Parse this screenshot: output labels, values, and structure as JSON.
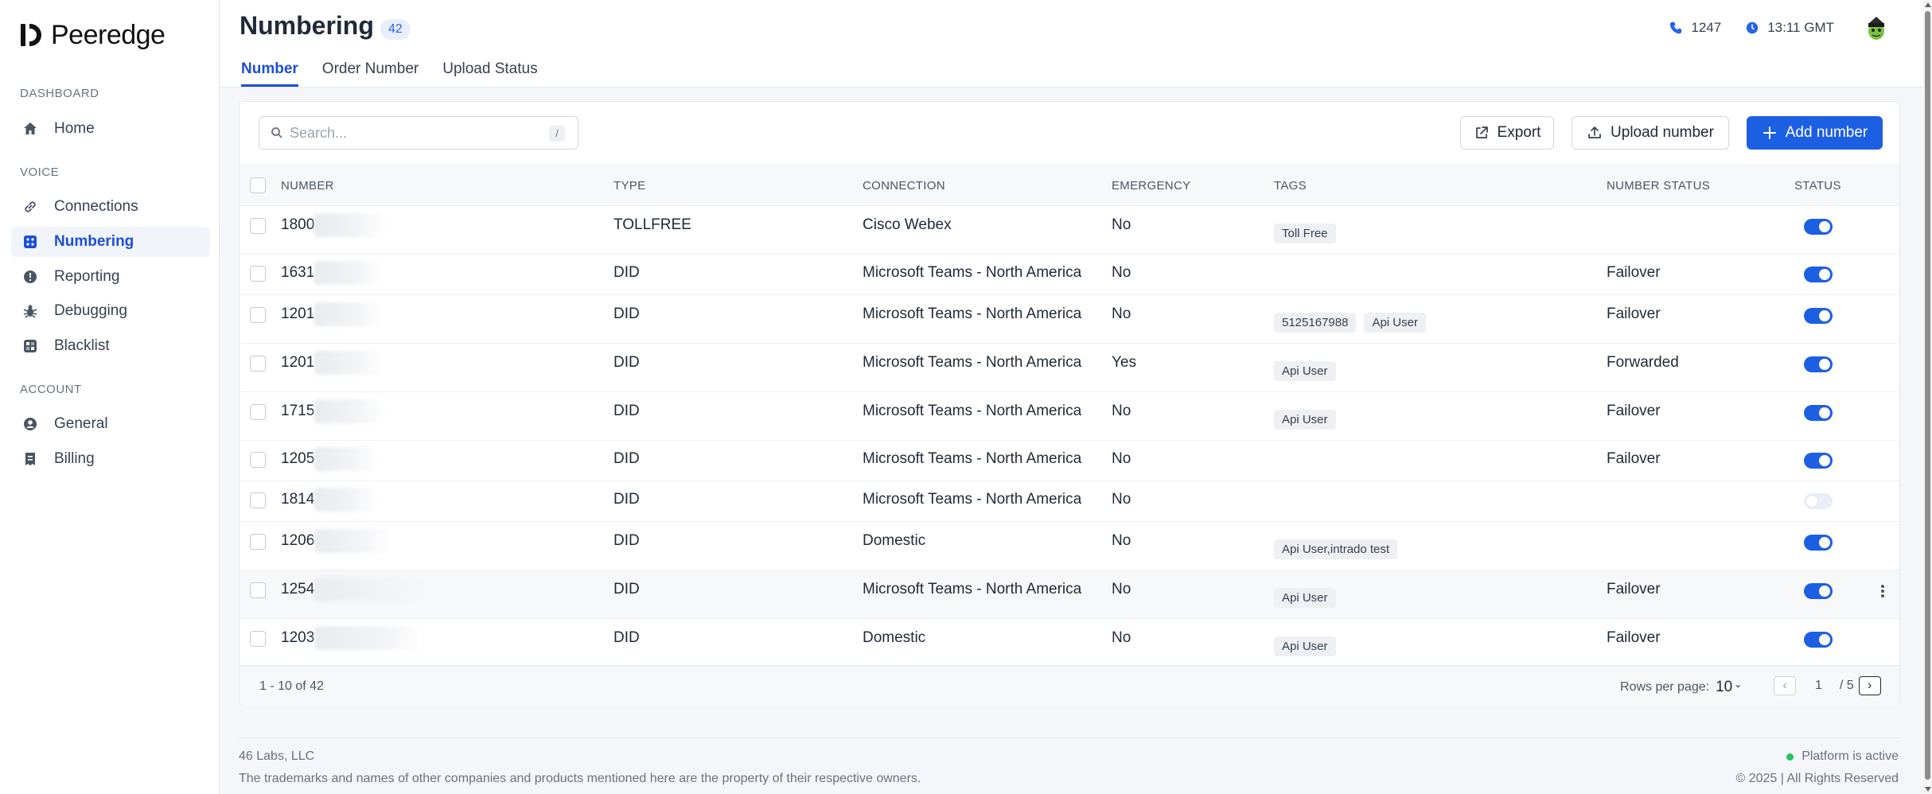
{
  "app": {
    "name": "Peeredge"
  },
  "sidebar": {
    "sections": [
      {
        "label": "DASHBOARD"
      },
      {
        "label": "VOICE"
      },
      {
        "label": "ACCOUNT"
      }
    ],
    "items": [
      {
        "label": "Home",
        "icon": "home-icon"
      },
      {
        "label": "Connections",
        "icon": "link-icon"
      },
      {
        "label": "Numbering",
        "icon": "grid-icon",
        "active": true
      },
      {
        "label": "Reporting",
        "icon": "alert-circle-icon"
      },
      {
        "label": "Debugging",
        "icon": "bug-icon"
      },
      {
        "label": "Blacklist",
        "icon": "blacklist-icon"
      },
      {
        "label": "General",
        "icon": "user-circle-icon"
      },
      {
        "label": "Billing",
        "icon": "receipt-icon"
      }
    ]
  },
  "header": {
    "title": "Numbering",
    "count": "42",
    "tabs": [
      {
        "label": "Number",
        "active": true
      },
      {
        "label": "Order Number"
      },
      {
        "label": "Upload Status"
      }
    ],
    "phone": "1247",
    "time": "13:11 GMT"
  },
  "toolbar": {
    "search_placeholder": "Search...",
    "search_shortcut": "/",
    "export_label": "Export",
    "upload_label": "Upload number",
    "add_label": "Add number"
  },
  "table": {
    "columns": [
      "NUMBER",
      "TYPE",
      "CONNECTION",
      "EMERGENCY",
      "TAGS",
      "NUMBER STATUS",
      "STATUS"
    ],
    "rows": [
      {
        "number": "1800",
        "type": "TOLLFREE",
        "connection": "Cisco Webex",
        "emergency": "No",
        "tags": [
          "Toll Free"
        ],
        "number_status": "",
        "status": true
      },
      {
        "number": "1631",
        "type": "DID",
        "connection": "Microsoft Teams - North America",
        "emergency": "No",
        "tags": [],
        "number_status": "Failover",
        "status": true
      },
      {
        "number": "1201",
        "type": "DID",
        "connection": "Microsoft Teams - North America",
        "emergency": "No",
        "tags": [
          "5125167988",
          "Api User"
        ],
        "number_status": "Failover",
        "status": true
      },
      {
        "number": "1201",
        "type": "DID",
        "connection": "Microsoft Teams - North America",
        "emergency": "Yes",
        "tags": [
          "Api User"
        ],
        "number_status": "Forwarded",
        "status": true
      },
      {
        "number": "1715",
        "type": "DID",
        "connection": "Microsoft Teams - North America",
        "emergency": "No",
        "tags": [
          "Api User"
        ],
        "number_status": "Failover",
        "status": true
      },
      {
        "number": "1205",
        "type": "DID",
        "connection": "Microsoft Teams - North America",
        "emergency": "No",
        "tags": [],
        "number_status": "Failover",
        "status": true
      },
      {
        "number": "1814",
        "type": "DID",
        "connection": "Microsoft Teams - North America",
        "emergency": "No",
        "tags": [],
        "number_status": "",
        "status": false
      },
      {
        "number": "1206",
        "type": "DID",
        "connection": "Domestic",
        "emergency": "No",
        "tags": [
          "Api User,intrado test"
        ],
        "number_status": "",
        "status": true
      },
      {
        "number": "1254",
        "type": "DID",
        "connection": "Microsoft Teams - North America",
        "emergency": "No",
        "tags": [
          "Api User"
        ],
        "number_status": "Failover",
        "status": true
      },
      {
        "number": "1203",
        "type": "DID",
        "connection": "Domestic",
        "emergency": "No",
        "tags": [
          "Api User"
        ],
        "number_status": "Failover",
        "status": true
      }
    ]
  },
  "pagination": {
    "range": "1 - 10 of 42",
    "rows_per_page_label": "Rows per page:",
    "rows_per_page": "10",
    "page": "1",
    "total_pages": "/ 5"
  },
  "footer": {
    "company": "46 Labs, LLC",
    "trademark": "The trademarks and names of other companies and products mentioned here are the property of their respective owners.",
    "platform_status": "Platform is active",
    "copyright": "© 2025 | All Rights Reserved"
  },
  "colors": {
    "accent": "#1d5fe3",
    "active_nav": "#1d4ed8",
    "status_dot": "#22c55e"
  }
}
